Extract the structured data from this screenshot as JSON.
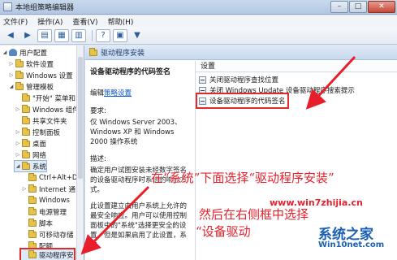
{
  "window": {
    "title": "本地组策略编辑器",
    "controls": {
      "minimize": "–",
      "maximize": "□",
      "close": "✕"
    }
  },
  "menu": [
    "文件(F)",
    "操作(A)",
    "查看(V)",
    "帮助(H)"
  ],
  "toolbar": [
    {
      "icon": "back-arrow-icon",
      "glyph": "◀"
    },
    {
      "icon": "forward-arrow-icon",
      "glyph": "▶"
    },
    {
      "icon": "up-folder-icon",
      "glyph": "▤"
    },
    {
      "icon": "show-hide-tree-icon",
      "glyph": "▦"
    },
    {
      "icon": "export-list-icon",
      "glyph": "▥"
    },
    {
      "icon": "help-icon",
      "glyph": "?"
    },
    {
      "icon": "properties-icon",
      "glyph": "▣"
    },
    {
      "icon": "filter-icon",
      "glyph": "▼"
    }
  ],
  "tree": {
    "items": [
      {
        "label": "用户配置",
        "expander": "◢",
        "icon": "user-icon"
      },
      {
        "label": "软件设置",
        "expander": "▷",
        "icon": "folder-icon"
      },
      {
        "label": "Windows 设置",
        "expander": "▷",
        "icon": "folder-icon"
      },
      {
        "label": "管理模板",
        "expander": "◢",
        "icon": "folder-icon"
      },
      {
        "label": "\"开始\" 菜单和",
        "expander": "",
        "icon": "folder-icon"
      },
      {
        "label": "Windows 组件",
        "expander": "▷",
        "icon": "folder-icon"
      },
      {
        "label": "共享文件夹",
        "expander": "",
        "icon": "folder-icon"
      },
      {
        "label": "控制面板",
        "expander": "▷",
        "icon": "folder-icon"
      },
      {
        "label": "桌面",
        "expander": "▷",
        "icon": "folder-icon"
      },
      {
        "label": "网络",
        "expander": "▷",
        "icon": "folder-icon"
      },
      {
        "label": "系统",
        "expander": "◢",
        "icon": "folder-icon"
      },
      {
        "label": "Ctrl+Alt+D",
        "expander": "",
        "icon": "folder-icon"
      },
      {
        "label": "Internet 通",
        "expander": "▷",
        "icon": "folder-icon"
      },
      {
        "label": "Windows",
        "expander": "",
        "icon": "folder-icon"
      },
      {
        "label": "电源管理",
        "expander": "",
        "icon": "folder-icon"
      },
      {
        "label": "脚本",
        "expander": "",
        "icon": "folder-icon"
      },
      {
        "label": "可移动存储",
        "expander": "",
        "icon": "folder-icon"
      },
      {
        "label": "配额",
        "expander": "",
        "icon": "folder-icon"
      },
      {
        "label": "驱动程序安",
        "expander": "",
        "icon": "folder-icon"
      }
    ]
  },
  "section_header": "驱动程序安装",
  "description": {
    "title": "设备驱动程序的代码签名",
    "edit_prefix": "编辑",
    "edit_link": "策略设置",
    "requirements_label": "要求:",
    "requirements_text": "仅 Windows Server 2003、Windows XP 和 Windows 2000 操作系统",
    "description_label": "描述:",
    "description_text": "确定用户试图安装未经数字签名的设备驱动程序时系统的响应方式。",
    "more_text": "此设置建立由用户系统上允许的最安全响应。用户可以使用控制面板中的\"系统\"选择更安全的设置，但是如果启用了此设置，系统"
  },
  "list": {
    "column_header": "设置",
    "rows": [
      "关闭驱动程序查找位置",
      "关闭 Windows Update 设备驱动程序搜索提示",
      "设备驱动程序的代码签名"
    ]
  },
  "annotations": {
    "line1": "在“系统”下面选择“驱动程序安装”",
    "line2": "然后在右侧框中选择",
    "line3": "“设备驱动"
  },
  "watermarks": {
    "site_url": "www.win7zhijia.cn",
    "brand_main": "系统之家",
    "brand_url": "Win10net.com"
  },
  "colors": {
    "annotation": "#e81f2b",
    "selection_box": "#e22a2a",
    "link": "#0b57c4"
  }
}
